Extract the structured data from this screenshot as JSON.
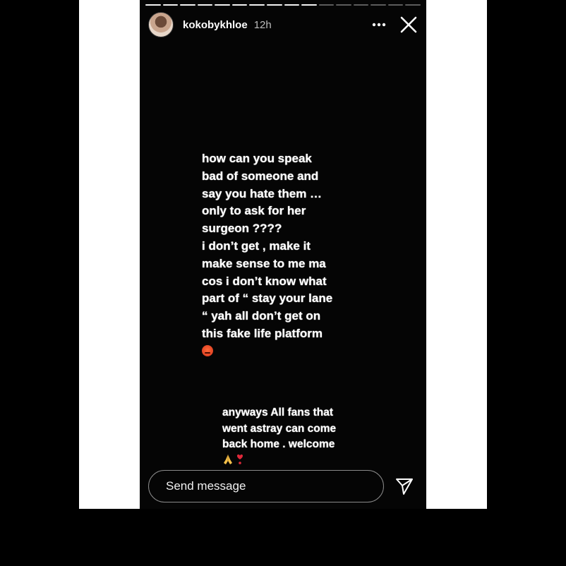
{
  "story": {
    "progress": {
      "total_segments": 16,
      "completed_segments": 10
    },
    "header": {
      "username": "kokobykhloe",
      "time_ago": "12h",
      "more_icon": "more-dots-icon",
      "close_icon": "close-icon"
    },
    "caption_main": {
      "lines": [
        "how can you speak",
        "bad of someone and",
        "say you hate them …",
        "only to ask for her",
        "surgeon ????",
        "i don’t get , make it",
        "make sense to me ma",
        "cos i don’t know what",
        "part of “ stay your lane",
        "“ yah all don’t get on",
        "this fake life platform"
      ],
      "emoji": "angry-face-emoji"
    },
    "caption_second": {
      "lines": [
        "anyways All fans that",
        "went astray can come",
        "back home . welcome"
      ],
      "emojis": [
        "folded-hands-emoji",
        "heart-exclamation-emoji"
      ]
    },
    "reply": {
      "placeholder": "Send message",
      "value": "",
      "send_icon": "send-icon"
    }
  },
  "colors": {
    "background": "#000000",
    "side_panels": "#ffffff",
    "story_bg": "#050505",
    "text": "#ffffff"
  }
}
